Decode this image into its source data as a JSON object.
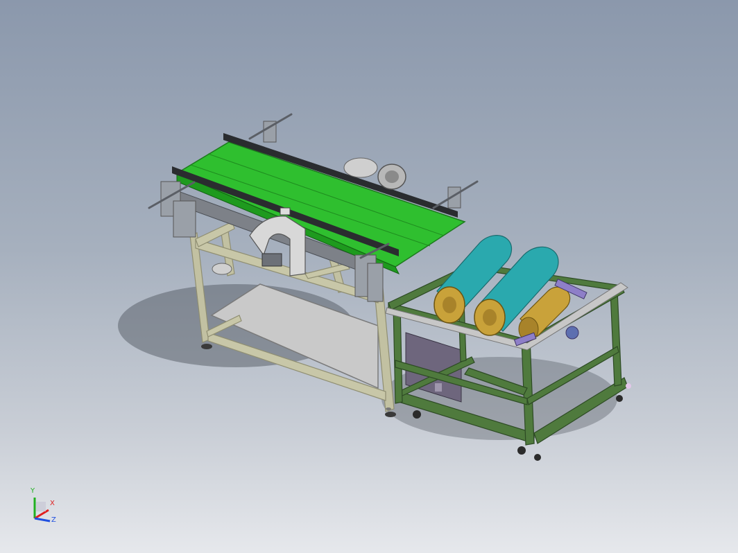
{
  "view": {
    "colors": {
      "belt": "#2fbf2f",
      "frame_left": "#b9b898",
      "frame_right": "#4f7a3d",
      "drum": "#2aa9ae",
      "drum_gold": "#c9a23a",
      "rail": "#2a2c2f",
      "shelf": "#b7b7b7",
      "cabinet": "#6e667d"
    }
  },
  "triad": {
    "x_label": "X",
    "y_label": "Y",
    "z_label": "Z",
    "x_color": "#e02020",
    "y_color": "#20b020",
    "z_color": "#2050e0"
  }
}
